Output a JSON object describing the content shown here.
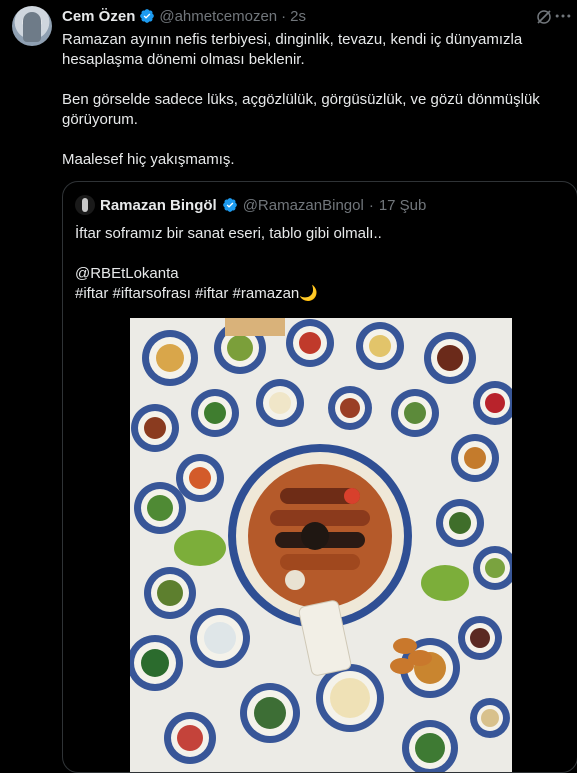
{
  "tweet": {
    "author_name": "Cem Özen",
    "author_handle": "@ahmetcemozen",
    "separator": "·",
    "time": "2s",
    "paragraphs": [
      "Ramazan ayının nefis terbiyesi, dinginlik, tevazu, kendi iç dünyamızla hesaplaşma dönemi olması beklenir.",
      "Ben görselde sadece lüks, açgözlülük, görgüsüzlük, ve gözü dönmüşlük görüyorum.",
      "Maalesef hiç yakışmamış."
    ]
  },
  "quoted_tweet": {
    "author_name": "Ramazan Bingöl",
    "author_handle": "@RamazanBingol",
    "separator": "·",
    "time": "17 Şub",
    "line1": "İftar soframız bir sanat eseri, tablo gibi olmalı..",
    "mention": "@RBEtLokanta",
    "hashtags": "#iftar #iftarsofrası  #iftar #ramazan🌙"
  },
  "colors": {
    "background": "#000000",
    "text": "#e7e9ea",
    "muted": "#71767b",
    "verified": "#1d9bf0",
    "border": "#2f3336"
  },
  "icons": [
    "verified-badge-icon",
    "grok-icon",
    "more-icon"
  ]
}
